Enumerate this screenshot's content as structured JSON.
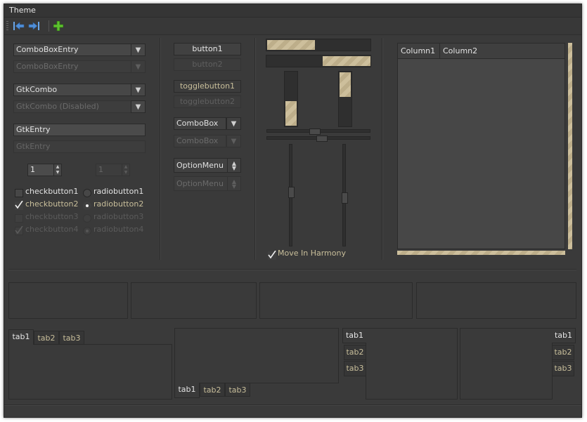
{
  "menubar": {
    "theme": "Theme"
  },
  "toolbar": {
    "back": "back-arrow-icon",
    "forward": "forward-arrow-icon",
    "add": "add-icon"
  },
  "column1": {
    "combobox_entry": "ComboBoxEntry",
    "combobox_entry_dis": "ComboBoxEntry",
    "gtkcombo": "GtkCombo",
    "gtkcombo_dis": "GtkCombo (Disabled)",
    "entry": "GtkEntry",
    "entry_dis": "GtkEntry",
    "spin": "1",
    "spin_dis": "1",
    "check1": "checkbutton1",
    "check2": "checkbutton2",
    "check3": "checkbutton3",
    "check4": "checkbutton4",
    "radio1": "radiobutton1",
    "radio2": "radiobutton2",
    "radio3": "radiobutton3",
    "radio4": "radiobutton4"
  },
  "column2": {
    "button1": "button1",
    "button2": "button2",
    "toggle1": "togglebutton1",
    "toggle2": "togglebutton2",
    "combobox": "ComboBox",
    "combobox_dis": "ComboBox",
    "optionmenu": "OptionMenu",
    "optionmenu_dis": "OptionMenu"
  },
  "column3": {
    "harmony": "Move In Harmony"
  },
  "tree": {
    "col1": "Column1",
    "col2": "Column2"
  },
  "notebooks": {
    "nb1": [
      "tab1",
      "tab2",
      "tab3"
    ],
    "nb2": [
      "tab1",
      "tab2",
      "tab3"
    ],
    "nb3": [
      "tab1",
      "tab2",
      "tab3"
    ],
    "nb4": [
      "tab1",
      "tab2",
      "tab3"
    ]
  },
  "colors": {
    "accent": "#cdbf9c",
    "background": "#3a3a3a",
    "inactive_text": "#c9bf9b"
  }
}
